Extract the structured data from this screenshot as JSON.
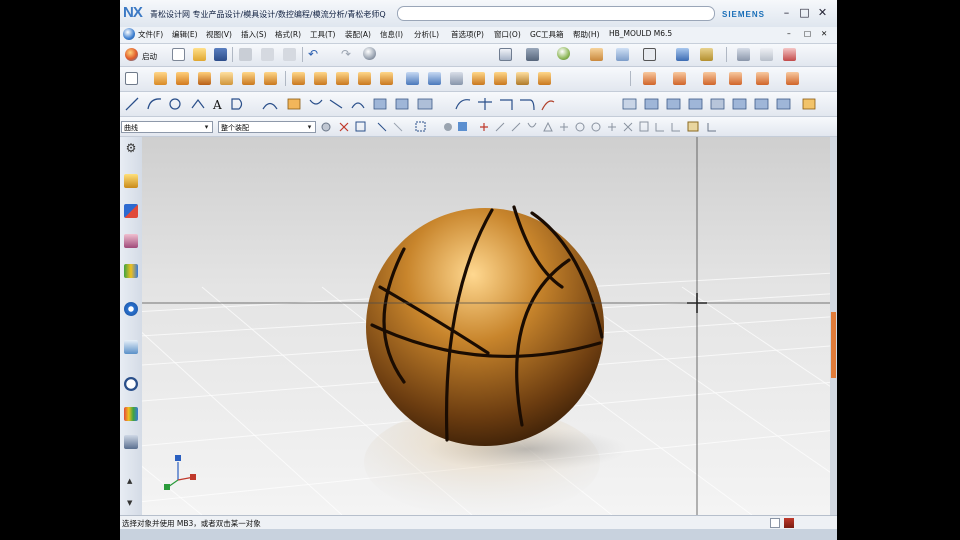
{
  "window": {
    "logo": "NX",
    "title": "青松设计网 专业产品设计/模具设计/数控编程/模流分析/青松老师Q",
    "brand": "SIEMENS",
    "controls": [
      "–",
      "□",
      "✕"
    ]
  },
  "menu": {
    "items": [
      "文件(F)",
      "编辑(E)",
      "视图(V)",
      "插入(S)",
      "格式(R)",
      "工具(T)",
      "装配(A)",
      "信息(I)",
      "分析(L)",
      "首选项(P)",
      "窗口(O)",
      "GC工具箱",
      "帮助(H)",
      "HB_MOULD M6.5"
    ],
    "right_controls": [
      "–",
      "□",
      "✕"
    ]
  },
  "toolbar1": {
    "start_label": "启动"
  },
  "selection": {
    "filter_value": "曲线",
    "scope_value": "整个装配"
  },
  "status": {
    "prompt": "选择对象并使用 MB3，或者双击某一对象"
  },
  "colors": {
    "accent": "#e07b39",
    "ball": "#c8852c",
    "brand": "#1a6fb8"
  },
  "icons": [
    "app-menu-icon",
    "start-icon",
    "new-icon",
    "open-icon",
    "save-icon",
    "cut-icon",
    "copy-icon",
    "paste-icon",
    "undo-icon",
    "redo-icon",
    "render-icon",
    "view-icon",
    "gear-icon",
    "wcs-icon"
  ]
}
